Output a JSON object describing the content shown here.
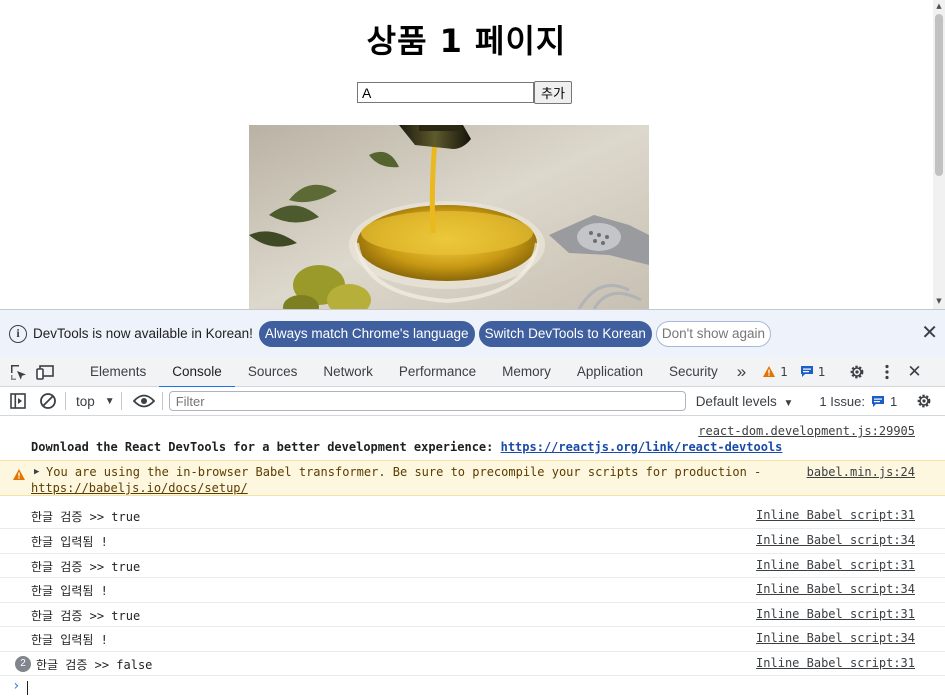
{
  "page": {
    "title": "상품 1 페이지",
    "input_value": "A",
    "add_button_label": "추가"
  },
  "infobar": {
    "message": "DevTools is now available in Korean!",
    "match_language_label": "Always match Chrome's language",
    "switch_korean_label": "Switch DevTools to Korean",
    "dont_show_label": "Don't show again"
  },
  "tabs": [
    "Elements",
    "Console",
    "Sources",
    "Network",
    "Performance",
    "Memory",
    "Application",
    "Security"
  ],
  "active_tab": "Console",
  "toolbar": {
    "more_tabs": "»",
    "warnings_count": "1",
    "messages_count": "1"
  },
  "filterbar": {
    "context": "top",
    "filter_placeholder": "Filter",
    "levels_label": "Default levels",
    "issues_label": "1 Issue:",
    "issues_count": "1"
  },
  "console": {
    "devtools_src": "react-dom.development.js:29905",
    "devtools_msg": "Download the React DevTools for a better development experience: ",
    "devtools_link": "https://reactjs.org/link/react-devtools",
    "warn_msg": "You are using the in-browser Babel transformer. Be sure to precompile your scripts for production - ",
    "warn_link": "https://babeljs.io/docs/setup/",
    "warn_src": "babel.min.js:24",
    "logs": [
      {
        "text": "한글 검증 >>  true",
        "src": "Inline Babel script:31"
      },
      {
        "text": "한글 입력됨 !",
        "src": "Inline Babel script:34"
      },
      {
        "text": "한글 검증 >>  true",
        "src": "Inline Babel script:31"
      },
      {
        "text": "한글 입력됨 !",
        "src": "Inline Babel script:34"
      },
      {
        "text": "한글 검증 >>  true",
        "src": "Inline Babel script:31"
      },
      {
        "text": "한글 입력됨 !",
        "src": "Inline Babel script:34"
      }
    ],
    "last_log": {
      "count": "2",
      "text": "한글 검증 >>  false",
      "src": "Inline Babel script:31"
    },
    "prompt": "›"
  },
  "colors": {
    "accent": "#1a73e8",
    "pill_bg": "#3f5f9e",
    "warning": "#e37400"
  }
}
